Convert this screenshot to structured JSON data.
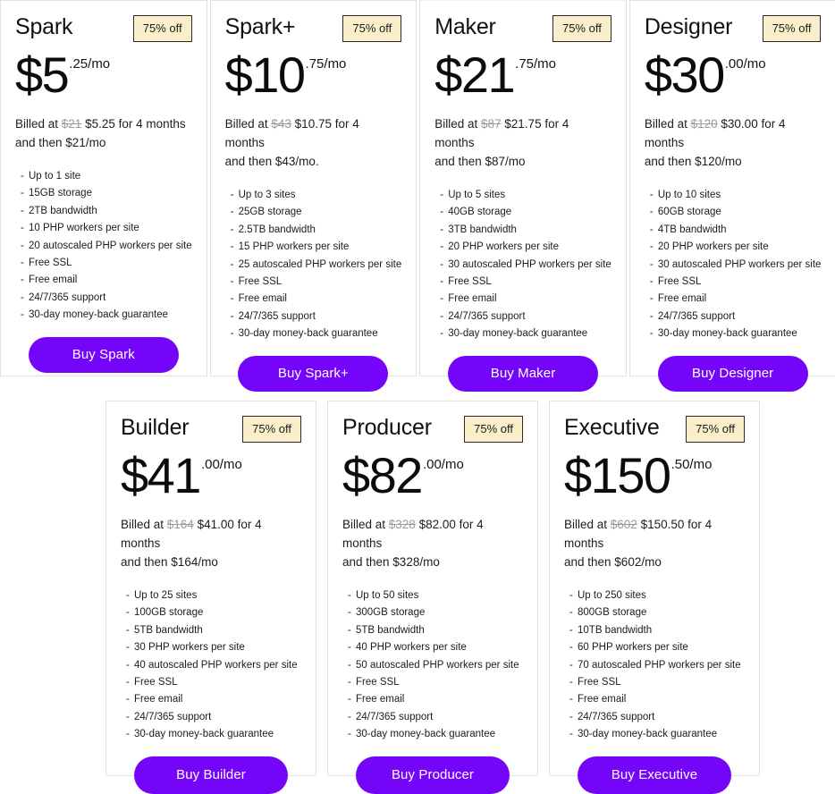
{
  "theme": {
    "buy_button_color": "#7505f9",
    "badge_background": "#faeecb",
    "badge_border": "#2b2b2b",
    "card_border": "#e2e2e2",
    "page_background": "#ffffff"
  },
  "rows": [
    {
      "cards": [
        {
          "name": "Spark",
          "badge": "75% off",
          "price_main": "$5",
          "price_suffix": ".25/mo",
          "billing_prefix": "Billed at ",
          "billing_original": "$21",
          "billing_middle": " $5.25 for 4 months",
          "billing_second_line": "and then $21/mo",
          "features": [
            "Up to 1 site",
            "15GB storage",
            "2TB bandwidth",
            "10 PHP workers per site",
            "20 autoscaled PHP workers per site",
            "Free SSL",
            "Free email",
            "24/7/365 support",
            "30-day money-back guarantee"
          ],
          "buy_label": "Buy Spark",
          "featured": false
        },
        {
          "name": "Spark+",
          "badge": "75% off",
          "price_main": "$10",
          "price_suffix": ".75/mo",
          "billing_prefix": "Billed at ",
          "billing_original": "$43",
          "billing_middle": " $10.75 for 4 months",
          "billing_second_line": "and then $43/mo.",
          "features": [
            "Up to 3 sites",
            "25GB storage",
            "2.5TB bandwidth",
            "15 PHP workers per site",
            "25 autoscaled PHP workers per site",
            "Free SSL",
            "Free email",
            "24/7/365 support",
            "30-day money-back guarantee"
          ],
          "buy_label": "Buy Spark+",
          "featured": false
        },
        {
          "name": "Maker",
          "badge": "75% off",
          "price_main": "$21",
          "price_suffix": ".75/mo",
          "billing_prefix": "Billed at ",
          "billing_original": "$87",
          "billing_middle": " $21.75 for 4 months",
          "billing_second_line": "and then $87/mo",
          "features": [
            "Up to 5 sites",
            "40GB storage",
            "3TB bandwidth",
            "20 PHP workers per site",
            "30 autoscaled PHP workers per site",
            "Free SSL",
            "Free email",
            "24/7/365 support",
            "30-day money-back guarantee"
          ],
          "buy_label": "Buy Maker",
          "featured": true
        },
        {
          "name": "Designer",
          "badge": "75% off",
          "price_main": "$30",
          "price_suffix": ".00/mo",
          "billing_prefix": "Billed at ",
          "billing_original": "$120",
          "billing_middle": " $30.00 for 4 months",
          "billing_second_line": "and then $120/mo",
          "features": [
            "Up to 10 sites",
            "60GB storage",
            "4TB bandwidth",
            "20 PHP workers per site",
            "30 autoscaled PHP workers per site",
            "Free SSL",
            "Free email",
            "24/7/365 support",
            "30-day money-back guarantee"
          ],
          "buy_label": "Buy Designer",
          "featured": false
        }
      ]
    },
    {
      "cards": [
        {
          "name": "Builder",
          "badge": "75% off",
          "price_main": "$41",
          "price_suffix": ".00/mo",
          "billing_prefix": "Billed at ",
          "billing_original": "$164",
          "billing_middle": " $41.00 for 4 months",
          "billing_second_line": "and then $164/mo",
          "features": [
            "Up to 25 sites",
            "100GB storage",
            "5TB bandwidth",
            "30 PHP workers per site",
            "40 autoscaled PHP workers per site",
            "Free SSL",
            "Free email",
            "24/7/365 support",
            "30-day money-back guarantee"
          ],
          "buy_label": "Buy Builder",
          "featured": false
        },
        {
          "name": "Producer",
          "badge": "75% off",
          "price_main": "$82",
          "price_suffix": ".00/mo",
          "billing_prefix": "Billed at ",
          "billing_original": "$328",
          "billing_middle": " $82.00 for 4 months",
          "billing_second_line": "and then $328/mo",
          "features": [
            "Up to 50 sites",
            "300GB storage",
            "5TB bandwidth",
            "40 PHP workers per site",
            "50 autoscaled PHP workers per site",
            "Free SSL",
            "Free email",
            "24/7/365 support",
            "30-day money-back guarantee"
          ],
          "buy_label": "Buy Producer",
          "featured": false
        },
        {
          "name": "Executive",
          "badge": "75% off",
          "price_main": "$150",
          "price_suffix": ".50/mo",
          "billing_prefix": "Billed at ",
          "billing_original": "$602",
          "billing_middle": " $150.50 for 4 months",
          "billing_second_line": "and then $602/mo",
          "features": [
            "Up to 250 sites",
            "800GB storage",
            "10TB bandwidth",
            "60 PHP workers per site",
            "70 autoscaled PHP workers per site",
            "Free SSL",
            "Free email",
            "24/7/365 support",
            "30-day money-back guarantee"
          ],
          "buy_label": "Buy Executive",
          "featured": false
        }
      ]
    }
  ]
}
